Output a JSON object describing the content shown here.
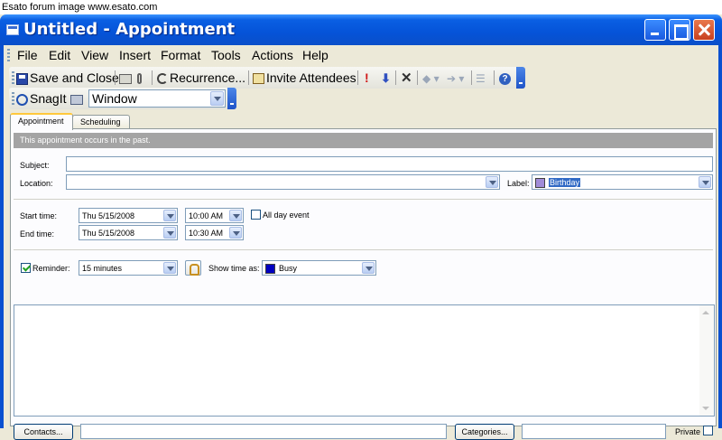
{
  "banner": "Esato forum image www.esato.com",
  "window": {
    "title": "Untitled - Appointment"
  },
  "menu": {
    "items": [
      {
        "label": "File"
      },
      {
        "label": "Edit"
      },
      {
        "label": "View"
      },
      {
        "label": "Insert"
      },
      {
        "label": "Format"
      },
      {
        "label": "Tools"
      },
      {
        "label": "Actions"
      },
      {
        "label": "Help"
      }
    ]
  },
  "toolbar": {
    "save_close": "Save and Close",
    "recurrence": "Recurrence...",
    "invite": "Invite Attendees"
  },
  "snagit": {
    "label": "SnagIt",
    "mode": "Window"
  },
  "tabs": [
    {
      "label": "Appointment"
    },
    {
      "label": "Scheduling"
    }
  ],
  "info": "This appointment occurs in the past.",
  "form": {
    "subject_label": "Subject:",
    "subject_value": "",
    "location_label": "Location:",
    "location_value": "",
    "label_label": "Label:",
    "label_value": "Birthday",
    "label_color": "#a08cd8",
    "start_label": "Start time:",
    "start_date": "Thu 5/15/2008",
    "start_time": "10:00 AM",
    "allday_label": "All day event",
    "allday_checked": false,
    "end_label": "End time:",
    "end_date": "Thu 5/15/2008",
    "end_time": "10:30 AM",
    "reminder_label": "Reminder:",
    "reminder_checked": true,
    "reminder_value": "15 minutes",
    "showas_label": "Show time as:",
    "showas_value": "Busy",
    "showas_color": "#0000c0"
  },
  "footer": {
    "contacts_button": "Contacts...",
    "contacts_value": "",
    "categories_button": "Categories...",
    "categories_value": "",
    "private_label": "Private",
    "private_checked": false
  },
  "icons": {
    "save": "save-icon",
    "print": "print-icon",
    "attach": "paperclip-icon",
    "recurrence": "recurrence-icon",
    "invite": "invite-attendees-icon",
    "importance_high": "exclamation-icon",
    "importance_low": "down-arrow-icon",
    "delete": "x-icon",
    "help": "help-icon",
    "snagit": "snagit-icon",
    "reminder": "bell-icon"
  },
  "colors": {
    "title_blue": "#0553d8",
    "close_red": "#c8401f",
    "tab_highlight": "#ffc83c"
  }
}
